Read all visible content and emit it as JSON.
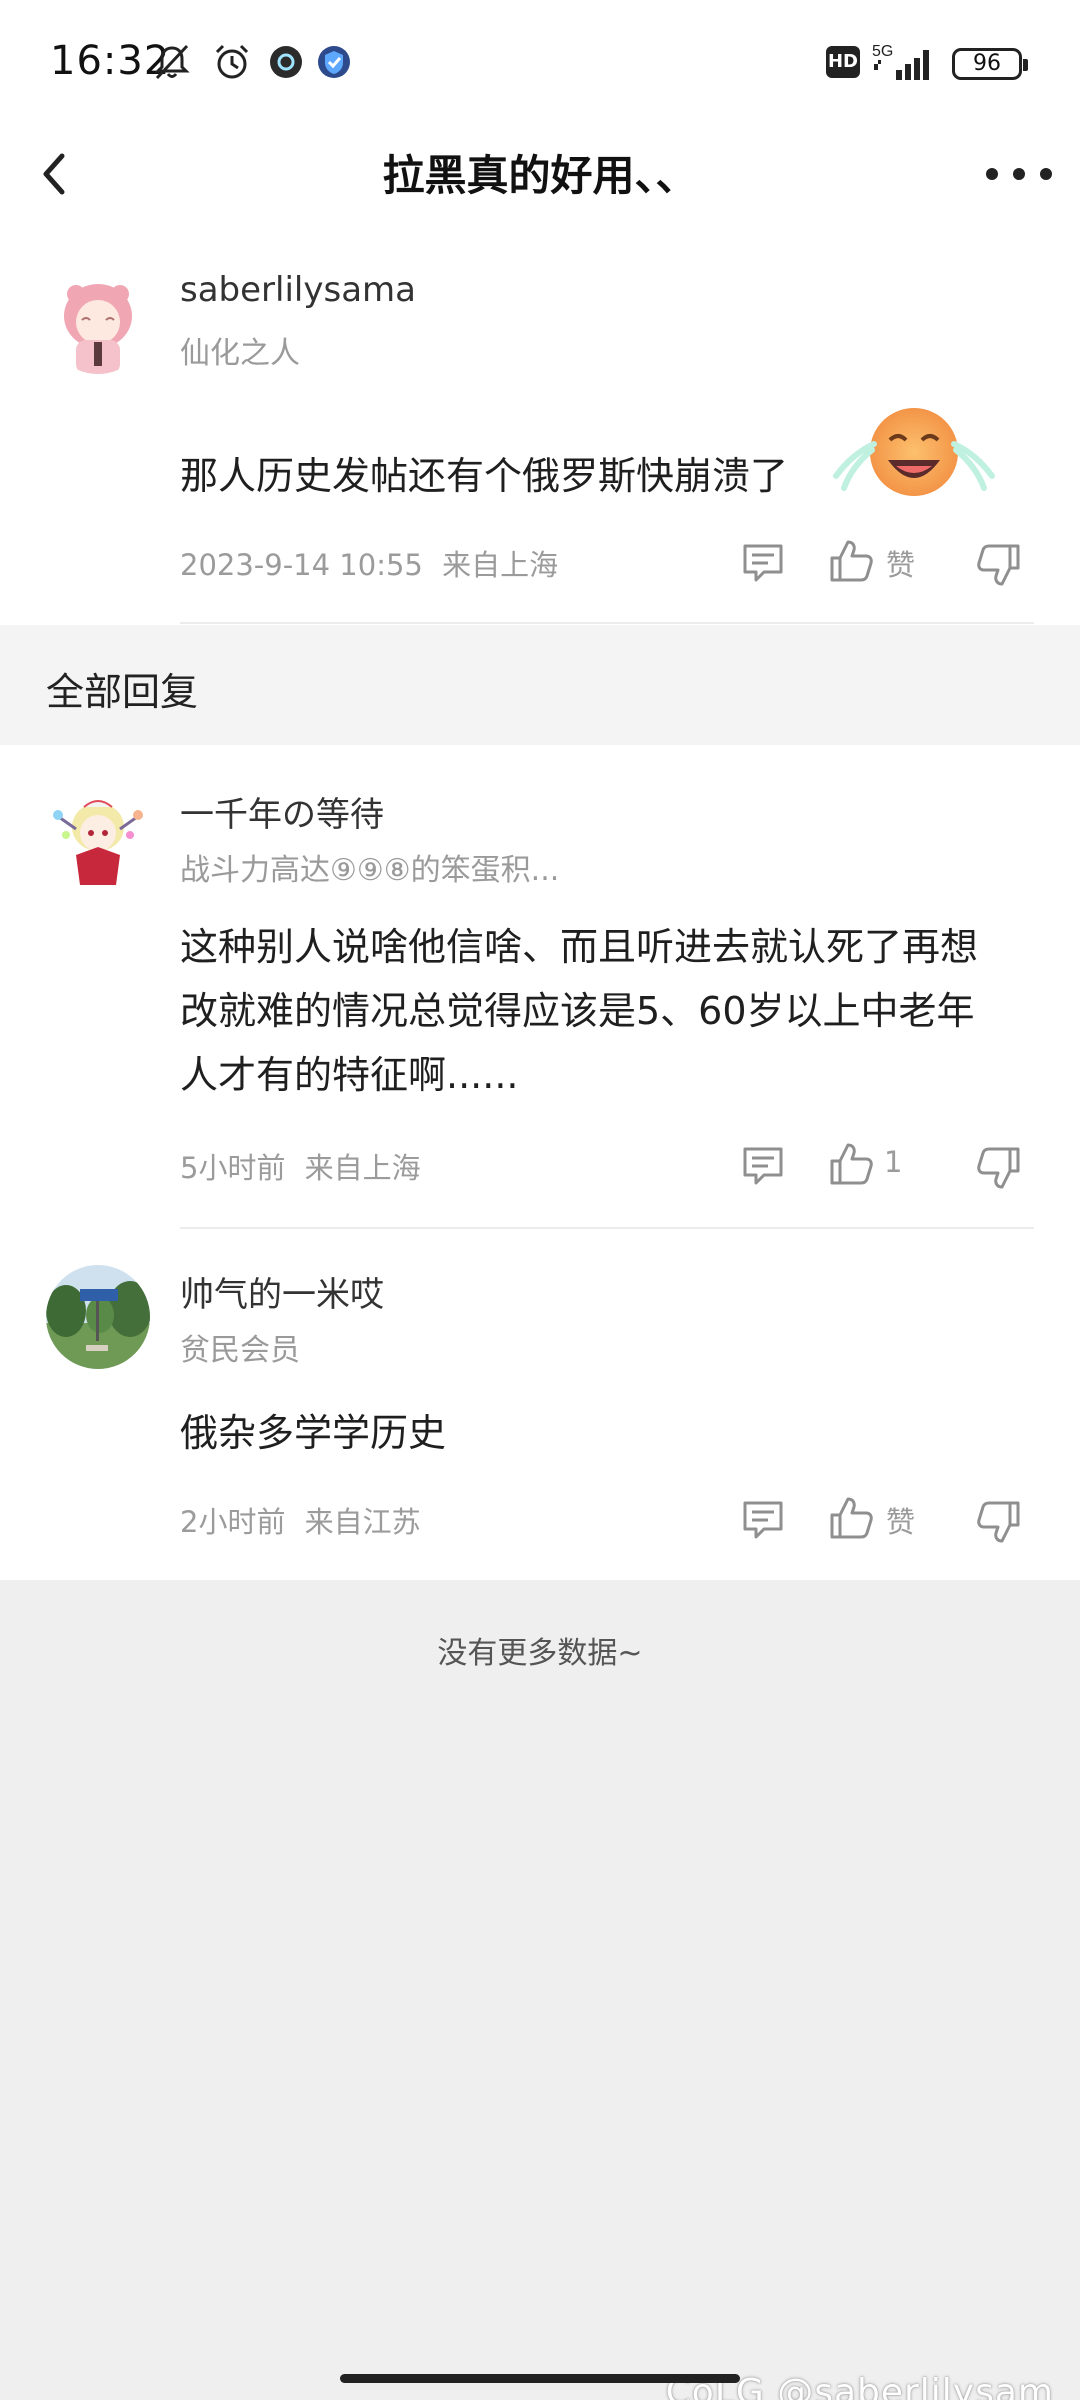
{
  "status_bar": {
    "time": "16:32",
    "network": "5G",
    "hd": "HD",
    "battery": "96",
    "icons": [
      "mute-icon",
      "alarm-icon",
      "app-notify-icon",
      "vpn-shield-icon",
      "signal-icon",
      "battery-icon"
    ]
  },
  "header": {
    "title": "拉黑真的好用、、",
    "back_icon": "chevron-left-icon",
    "more_icon": "more-dots-icon"
  },
  "post": {
    "username": "saberlilysama",
    "user_title": "仙化之人",
    "content": "那人历史发帖还有个俄罗斯快崩溃了",
    "emoji": "crying-laugh-emoji",
    "time": "2023-9-14 10:55",
    "location": "来自上海",
    "like_label": "赞"
  },
  "section": {
    "title": "全部回复"
  },
  "replies": [
    {
      "username": "一千年の等待",
      "user_title": "战斗力高达⑨⑨⑧的笨蛋积...",
      "content_lines": [
        "这种别人说啥他信啥、而且听进去就认死了再想",
        "改就难的情况总觉得应该是5、60岁以上中老年",
        "人才有的特征啊......"
      ],
      "time": "5小时前",
      "location": "来自上海",
      "like_label": "1"
    },
    {
      "username": "帅气的一米哎",
      "user_title": "贫民会员",
      "content_lines": [
        "俄杂多学学历史"
      ],
      "time": "2小时前",
      "location": "来自江苏",
      "like_label": "赞"
    }
  ],
  "footer": {
    "no_more": "没有更多数据~"
  },
  "watermark": "@saberlilysam",
  "watermark_brand": "CoLG"
}
